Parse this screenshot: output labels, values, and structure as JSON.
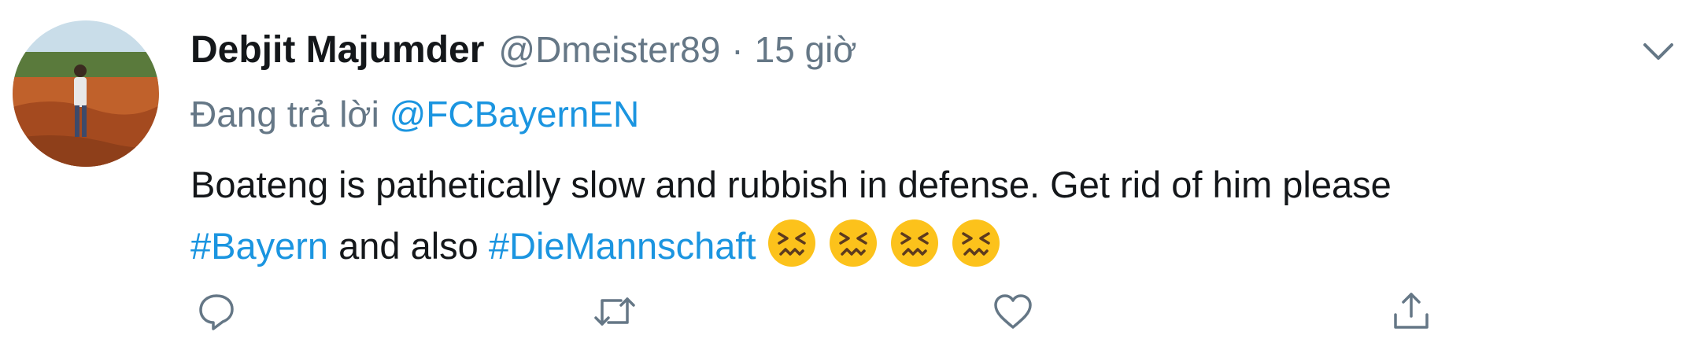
{
  "tweet": {
    "author_name": "Debjit Majumder",
    "author_handle": "@Dmeister89",
    "separator": "·",
    "time": "15 giờ",
    "reply_prefix": "Đang trả lời",
    "reply_to": "@FCBayernEN",
    "text_line1": "Boateng is pathetically slow and rubbish in defense. Get rid of him please",
    "hashtag1": "#Bayern",
    "text_mid": "and also",
    "hashtag2": "#DieMannschaft",
    "emojis": [
      "confounded-face",
      "confounded-face",
      "confounded-face",
      "confounded-face"
    ]
  },
  "actions": {
    "icons": [
      "reply-icon",
      "retweet-icon",
      "like-icon",
      "share-icon"
    ]
  },
  "colors": {
    "link": "#1b95e0",
    "muted": "#657786",
    "text": "#14171a"
  }
}
